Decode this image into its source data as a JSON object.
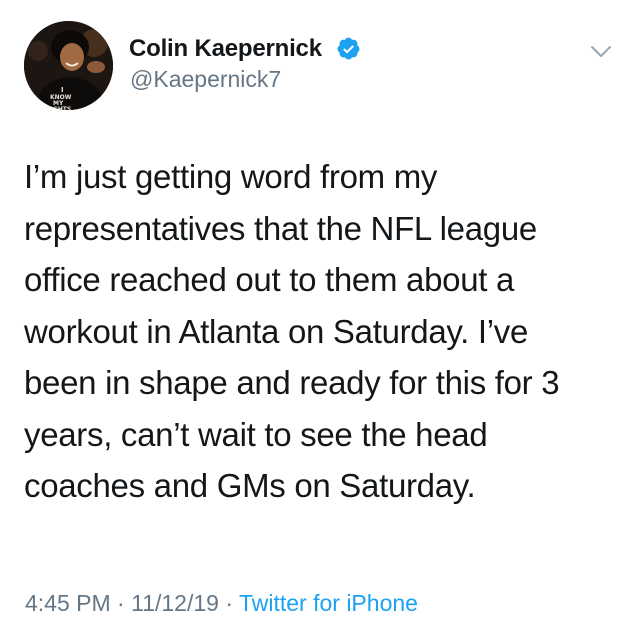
{
  "tweet": {
    "author": {
      "display_name": "Colin Kaepernick",
      "handle": "@Kaepernick7",
      "verified": true,
      "avatar_icon": "profile-photo-avatar",
      "avatar_shirt_text": "I KNOW MY RIGHTS"
    },
    "menu_icon": "chevron-down-icon",
    "text": "I’m just getting word from my\nrepresentatives that the NFL league\noffice reached out to them about a\nworkout in Atlanta on Saturday. I’ve\nbeen in shape and ready for this for 3\nyears, can’t wait to see the head\ncoaches and GMs on Saturday.",
    "meta": {
      "time": "4:45 PM",
      "separator1": " · ",
      "date": "11/12/19",
      "separator2": " · ",
      "source": "Twitter for iPhone"
    }
  },
  "colors": {
    "text_primary": "#14171a",
    "text_secondary": "#657786",
    "accent": "#1da1f2"
  }
}
